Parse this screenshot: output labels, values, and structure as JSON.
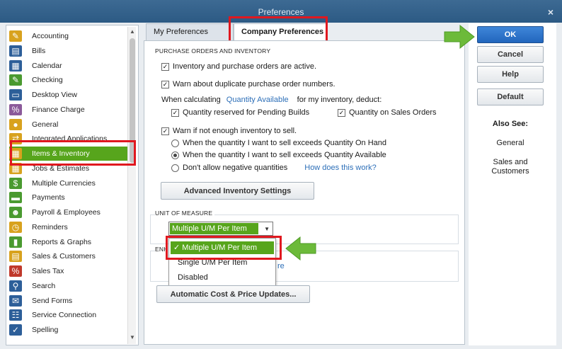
{
  "window": {
    "title": "Preferences",
    "close": "×"
  },
  "sidebar": {
    "items": [
      {
        "label": "Accounting",
        "icon": "accounting-icon",
        "color": "#d8a21e",
        "glyph": "✎"
      },
      {
        "label": "Bills",
        "icon": "bills-icon",
        "color": "#2d5f99",
        "glyph": "▤"
      },
      {
        "label": "Calendar",
        "icon": "calendar-icon",
        "color": "#2d5f99",
        "glyph": "▦"
      },
      {
        "label": "Checking",
        "icon": "checking-icon",
        "color": "#4a9a30",
        "glyph": "✎"
      },
      {
        "label": "Desktop View",
        "icon": "desktop-view-icon",
        "color": "#2d5f99",
        "glyph": "▭"
      },
      {
        "label": "Finance Charge",
        "icon": "finance-charge-icon",
        "color": "#8b5a9a",
        "glyph": "%"
      },
      {
        "label": "General",
        "icon": "general-icon",
        "color": "#d8a21e",
        "glyph": "●"
      },
      {
        "label": "Integrated Applications",
        "icon": "integrated-applications-icon",
        "color": "#d8a21e",
        "glyph": "⇄"
      },
      {
        "label": "Items & Inventory",
        "icon": "items-inventory-icon",
        "color": "#d8a21e",
        "glyph": "▦"
      },
      {
        "label": "Jobs & Estimates",
        "icon": "jobs-estimates-icon",
        "color": "#d8a21e",
        "glyph": "▦"
      },
      {
        "label": "Multiple Currencies",
        "icon": "multiple-currencies-icon",
        "color": "#4a9a30",
        "glyph": "$"
      },
      {
        "label": "Payments",
        "icon": "payments-icon",
        "color": "#4a9a30",
        "glyph": "▬"
      },
      {
        "label": "Payroll & Employees",
        "icon": "payroll-employees-icon",
        "color": "#4a9a30",
        "glyph": "☻"
      },
      {
        "label": "Reminders",
        "icon": "reminders-icon",
        "color": "#d8a21e",
        "glyph": "◷"
      },
      {
        "label": "Reports & Graphs",
        "icon": "reports-graphs-icon",
        "color": "#4a9a30",
        "glyph": "▮"
      },
      {
        "label": "Sales & Customers",
        "icon": "sales-customers-icon",
        "color": "#d8a21e",
        "glyph": "▤"
      },
      {
        "label": "Sales Tax",
        "icon": "sales-tax-icon",
        "color": "#c0392b",
        "glyph": "%"
      },
      {
        "label": "Search",
        "icon": "search-icon",
        "color": "#2d5f99",
        "glyph": "⚲"
      },
      {
        "label": "Send Forms",
        "icon": "send-forms-icon",
        "color": "#2d5f99",
        "glyph": "✉"
      },
      {
        "label": "Service Connection",
        "icon": "service-connection-icon",
        "color": "#2d5f99",
        "glyph": "☷"
      },
      {
        "label": "Spelling",
        "icon": "spelling-icon",
        "color": "#2d5f99",
        "glyph": "✓"
      }
    ],
    "selected_index": 8,
    "scroll_up": "▲",
    "scroll_down": "▼"
  },
  "tabs": {
    "my": "My Preferences",
    "company": "Company Preferences"
  },
  "purchase": {
    "title": "PURCHASE ORDERS AND INVENTORY",
    "inventory_po_active": "Inventory and purchase orders are active.",
    "warn_duplicate": "Warn about duplicate purchase order numbers.",
    "when_calculating": "When calculating",
    "quantity_available_link": "Quantity Available",
    "for_inventory_deduct": "for my inventory, deduct:",
    "qty_reserved": "Quantity reserved for Pending Builds",
    "qty_sales_orders": "Quantity on Sales Orders",
    "warn_not_enough": "Warn if not enough inventory to sell.",
    "opt_on_hand": "When the quantity I want to sell exceeds Quantity On Hand",
    "opt_available": "When the quantity I want to sell exceeds Quantity Available",
    "opt_no_negative": "Don't allow negative quantities",
    "how_does_this_work": "How does this work?",
    "check": "✓"
  },
  "advanced_button": "Advanced Inventory Settings",
  "uom": {
    "title": "UNIT OF MEASURE",
    "selected": "Multiple U/M Per Item",
    "arrow": "▼",
    "options": [
      "Multiple U/M Per Item",
      "Single U/M Per Item",
      "Disabled"
    ],
    "check": "✓"
  },
  "enhanced": {
    "title_partial": "ENH",
    "link_partial": "re"
  },
  "auto_cost_button": "Automatic Cost & Price Updates...",
  "right": {
    "ok": "OK",
    "cancel": "Cancel",
    "help": "Help",
    "default": "Default",
    "also_see": "Also See:",
    "general": "General",
    "sales_customers": "Sales and Customers"
  },
  "colors": {
    "accent_green": "#57a51c",
    "highlight_red": "#e0181f",
    "ok_blue": "#2b6fc7",
    "arrow_green": "#6cba3a"
  }
}
